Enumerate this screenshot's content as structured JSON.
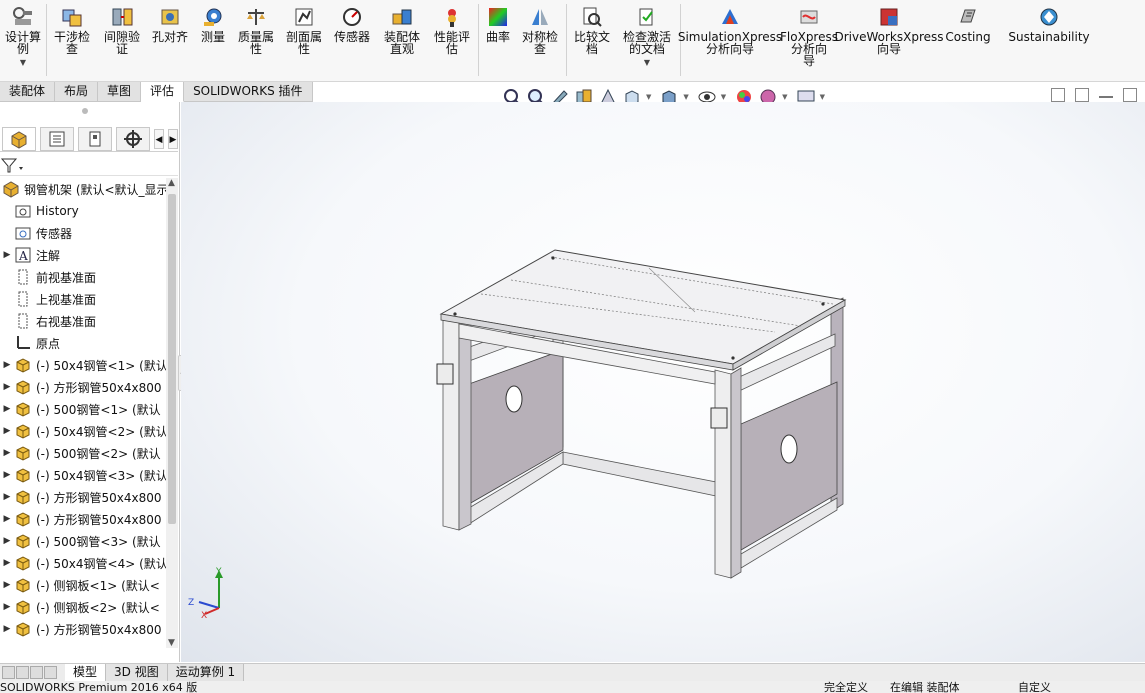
{
  "ribbon": {
    "buttons": [
      {
        "label": "设计算\n例",
        "icon": "design-study-icon"
      },
      {
        "label": "干涉检\n查",
        "icon": "interference-check-icon"
      },
      {
        "label": "间隙验\n证",
        "icon": "clearance-verify-icon"
      },
      {
        "label": "孔对齐",
        "icon": "hole-alignment-icon"
      },
      {
        "label": "测量",
        "icon": "measure-icon"
      },
      {
        "label": "质量属\n性",
        "icon": "mass-properties-icon"
      },
      {
        "label": "剖面属\n性",
        "icon": "section-properties-icon"
      },
      {
        "label": "传感器",
        "icon": "sensor-icon"
      },
      {
        "label": "装配体\n直观",
        "icon": "assembly-visualization-icon"
      },
      {
        "label": "性能评\n估",
        "icon": "performance-evaluation-icon"
      },
      {
        "label": "曲率",
        "icon": "curvature-icon"
      },
      {
        "label": "对称检\n查",
        "icon": "symmetry-check-icon"
      },
      {
        "label": "比较文\n档",
        "icon": "compare-documents-icon"
      },
      {
        "label": "检查激活\n的文档",
        "icon": "check-active-document-icon"
      },
      {
        "label": "SimulationXpress\n分析向导",
        "icon": "simulationxpress-icon"
      },
      {
        "label": "FloXpress\n分析向\n导",
        "icon": "floxpress-icon"
      },
      {
        "label": "DriveWorksXpress\n向导",
        "icon": "driveworksxpress-icon"
      },
      {
        "label": "Costing",
        "icon": "costing-icon"
      },
      {
        "label": "Sustainability",
        "icon": "sustainability-icon"
      }
    ]
  },
  "tabs": [
    "装配体",
    "布局",
    "草图",
    "评估",
    "SOLIDWORKS 插件"
  ],
  "active_tab": "评估",
  "feature_tree": {
    "root": "钢管机架  (默认<默认_显示",
    "items": [
      {
        "label": "History",
        "icon": "history-folder-icon",
        "expand": false
      },
      {
        "label": "传感器",
        "icon": "sensor-folder-icon",
        "expand": false
      },
      {
        "label": "注解",
        "icon": "annotation-icon",
        "expand": true
      },
      {
        "label": "前视基准面",
        "icon": "plane-icon",
        "expand": false
      },
      {
        "label": "上视基准面",
        "icon": "plane-icon",
        "expand": false
      },
      {
        "label": "右视基准面",
        "icon": "plane-icon",
        "expand": false
      },
      {
        "label": "原点",
        "icon": "origin-icon",
        "expand": false
      },
      {
        "label": "(-) 50x4钢管<1> (默认",
        "icon": "part-icon",
        "expand": true
      },
      {
        "label": "(-) 方形钢管50x4x800",
        "icon": "part-icon",
        "expand": true
      },
      {
        "label": "(-) 500钢管<1> (默认",
        "icon": "part-icon",
        "expand": true
      },
      {
        "label": "(-) 50x4钢管<2> (默认",
        "icon": "part-icon",
        "expand": true
      },
      {
        "label": "(-) 500钢管<2> (默认",
        "icon": "part-icon",
        "expand": true
      },
      {
        "label": "(-) 50x4钢管<3> (默认",
        "icon": "part-icon",
        "expand": true
      },
      {
        "label": "(-) 方形钢管50x4x800",
        "icon": "part-icon",
        "expand": true
      },
      {
        "label": "(-) 方形钢管50x4x800",
        "icon": "part-icon",
        "expand": true
      },
      {
        "label": "(-) 500钢管<3> (默认",
        "icon": "part-icon",
        "expand": true
      },
      {
        "label": "(-) 50x4钢管<4> (默认",
        "icon": "part-icon",
        "expand": true
      },
      {
        "label": "(-) 侧钢板<1> (默认<",
        "icon": "part-icon",
        "expand": true
      },
      {
        "label": "(-) 侧钢板<2> (默认<",
        "icon": "part-icon",
        "expand": true
      },
      {
        "label": "(-) 方形钢管50x4x800",
        "icon": "part-icon",
        "expand": true
      }
    ]
  },
  "triad": {
    "x": "X",
    "y": "Y",
    "z": "Z"
  },
  "bottom_tabs": [
    "模型",
    "3D 视图",
    "运动算例 1"
  ],
  "active_bottom_tab": "模型",
  "status": {
    "left": "SOLIDWORKS Premium 2016 x64 版",
    "mid1": "完全定义",
    "mid2": "在编辑 装配体",
    "right": "自定义"
  },
  "colors": {
    "accent": "#1a5fb4",
    "frame_light": "#e8e8ea",
    "panel_fill": "#b7b0b8"
  }
}
